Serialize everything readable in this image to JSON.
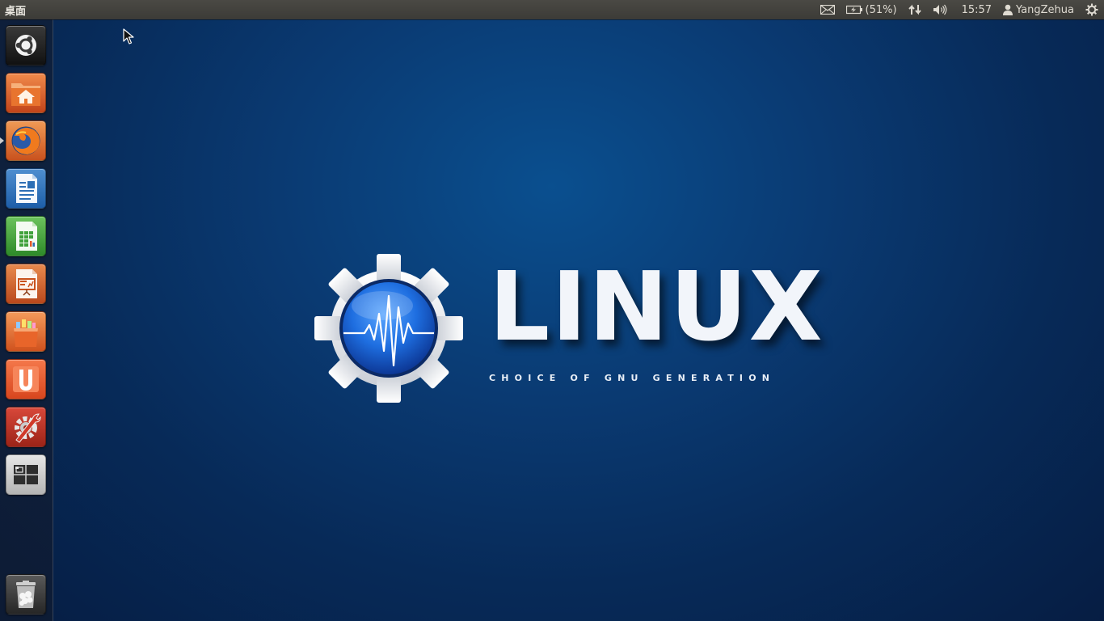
{
  "top_panel": {
    "title": "桌面",
    "battery": "(51%)",
    "time": "15:57",
    "user": "YangZehua",
    "icons": [
      "mail-icon",
      "battery-icon",
      "network-icon",
      "volume-icon",
      "user-icon",
      "session-gear-icon"
    ]
  },
  "launcher": {
    "items": [
      {
        "name": "dash-home",
        "icon": "ubuntu-logo-icon"
      },
      {
        "name": "home-folder",
        "icon": "home-folder-icon"
      },
      {
        "name": "firefox",
        "icon": "firefox-icon"
      },
      {
        "name": "libreoffice-writer",
        "icon": "writer-icon"
      },
      {
        "name": "libreoffice-calc",
        "icon": "calc-icon"
      },
      {
        "name": "libreoffice-impress",
        "icon": "impress-icon"
      },
      {
        "name": "software-center",
        "icon": "shopping-bag-icon"
      },
      {
        "name": "ubuntu-one",
        "icon": "ubuntu-one-icon"
      },
      {
        "name": "system-settings",
        "icon": "settings-icon"
      },
      {
        "name": "workspace-switcher",
        "icon": "workspaces-icon"
      },
      {
        "name": "trash",
        "icon": "trash-icon"
      }
    ],
    "colors": {
      "orange": "#e45c1c",
      "blue": "#2d6fb5",
      "green": "#3fa13a"
    }
  },
  "wallpaper": {
    "title": "LINUX",
    "subtitle": "CHOICE OF GNU GENERATION",
    "colors": {
      "bg_top": "#0a4f8f",
      "bg_bottom": "#061d43",
      "orb": "#1e6ee0"
    }
  }
}
